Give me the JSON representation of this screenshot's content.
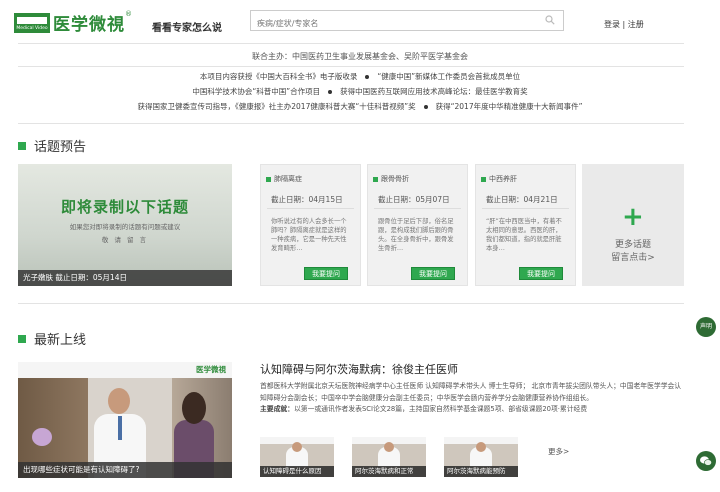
{
  "header": {
    "logo_en": "Medical Video",
    "logo_cn": "医学微視",
    "logo_reg": "®",
    "slogan": "看看专家怎么说",
    "search_placeholder": "疾病/症状/专家名",
    "login": "登录",
    "divider": "|",
    "register": "注册"
  },
  "sponsor": "联合主办：中国医药卫生事业发展基金会、吴阶平医学基金会",
  "awards": [
    [
      "本项目内容获授《中国大百科全书》电子版收录",
      "“健康中国”新媒体工作委员会首批成员单位"
    ],
    [
      "中国科学技术协会“科普中国”合作项目",
      "获得中国医药互联网应用技术高峰论坛：最佳医学教育奖"
    ],
    [
      "获得国家卫健委宣传司指导，《健康报》社主办2017健康科普大赛“十佳科普视频”奖",
      "获得“2017年度中华精准健康十大新闻事件”"
    ]
  ],
  "topics_section": {
    "title": "话题预告",
    "feature": {
      "headline": "即将录制以下话题",
      "sub": "如果您对即将录制的话题有问题或建议",
      "sub2": "敬 请 留 言",
      "caption": "光子嫩肤    截止日期：05月14日"
    },
    "cards": [
      {
        "tag": "肺隔离症",
        "date": "截止日期：04月15日",
        "desc": "你听说过有的人会多长一个肺吗？肺隔离症就是这样的一种疾病，它是一种先天性发育畸形…",
        "button": "我要提问"
      },
      {
        "tag": "跟骨骨折",
        "date": "截止日期：05月07日",
        "desc": "跟骨位于足后下部，俗名足跟，是构成我们脚后跟的骨头。在全身骨折中，跟骨发生骨折…",
        "button": "我要提问"
      },
      {
        "tag": "中西养肝",
        "date": "截止日期：04月21日",
        "desc": "“肝”在中西医当中，有着不太相同的意思。西医的肝，我们都知道，指的就是肝脏本身…",
        "button": "我要提问"
      }
    ],
    "more": {
      "plus": "+",
      "line1": "更多话题",
      "line2": "留言点击>"
    }
  },
  "latest_section": {
    "title": "最新上线",
    "video": {
      "logo": "医学微視",
      "caption": "出现哪些症状可能是有认知障碍了?"
    },
    "article": {
      "title": "认知障碍与阿尔茨海默病：徐俊主任医师",
      "bio": "首都医科大学附属北京天坛医院神经病学中心主任医师 认知障碍学术带头人 博士生导师； 北京市青年拔尖团队带头人；中国老年医学学会认知障碍分会副会长；中国卒中学会脑健康分会副主任委员；中华医学会肠内营养学分会脑健康营养协作组组长。",
      "achievement_label": "主要成就：",
      "achievement": "以第一或通讯作者发表SCI论文28篇，主持国家自然科学基金课题5项、部省级课题20项·累计经费"
    },
    "thumbs": [
      "认知障碍是什么原因",
      "阿尔茨海默病和正常",
      "阿尔茨海默病能预防"
    ],
    "more": "更多>"
  },
  "floating": {
    "statement": "声明",
    "wechat": "微信"
  },
  "colors": {
    "brand_green": "#2e8b3a",
    "button_green": "#2fa84f"
  }
}
